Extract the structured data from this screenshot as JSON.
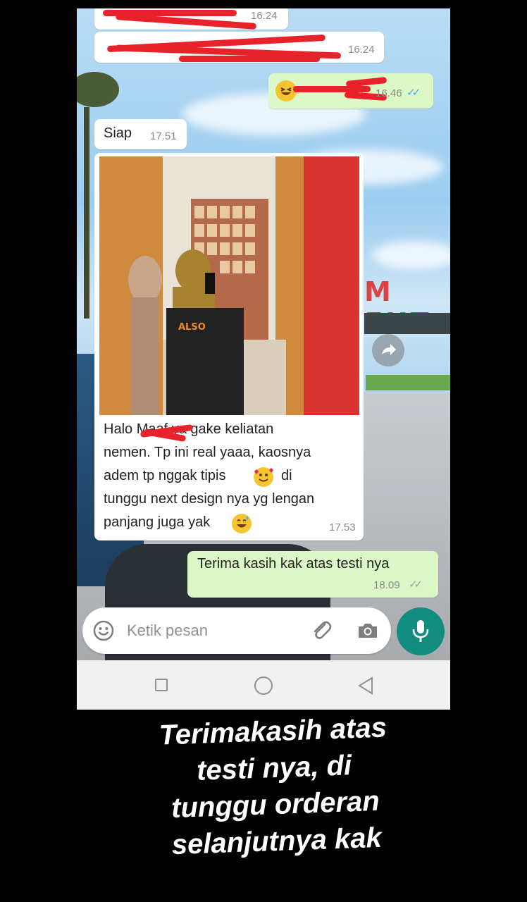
{
  "chat": {
    "messages": [
      {
        "type": "in",
        "text": "",
        "time": "16.24",
        "redacted": true
      },
      {
        "type": "in",
        "text": "",
        "time": "16.24",
        "redacted": true
      },
      {
        "type": "out",
        "text": "re",
        "time": "16.46",
        "status": "read",
        "emoji": "laughing-face"
      },
      {
        "type": "in",
        "text": "Siap",
        "time": "17.51"
      },
      {
        "type": "in-image",
        "caption_lines": [
          "Halo        Maaf ya gake keliatan",
          "nemen. Tp ini real yaaa, kaosnya",
          "adem tp nggak tipis",
          "di",
          "tunggu next design nya yg lengan",
          "panjang juga yak"
        ],
        "time": "17.53"
      },
      {
        "type": "out",
        "text": "Terima kasih kak atas testi nya",
        "time": "18.09",
        "status": "delivered"
      }
    ]
  },
  "input": {
    "placeholder": "Ketik pesan",
    "emoji_icon": "smiley-icon",
    "attach_icon": "paperclip-icon",
    "camera_icon": "camera-icon",
    "mic_icon": "microphone-icon"
  },
  "photo": {
    "shirt_text": "ALSO"
  },
  "navbar": {
    "icons": [
      "square-icon",
      "circle-icon",
      "back-triangle-icon"
    ]
  },
  "caption": {
    "lines": [
      "Terimakasih atas",
      "testi nya, di",
      "tunggu  orderan",
      "selanjutnya kak"
    ]
  },
  "colors": {
    "outgoing_bubble": "#dcf8c6",
    "incoming_bubble": "#ffffff",
    "accent": "#128c7e",
    "read_ticks": "#4fa6e8",
    "redaction": "#e8222a"
  }
}
